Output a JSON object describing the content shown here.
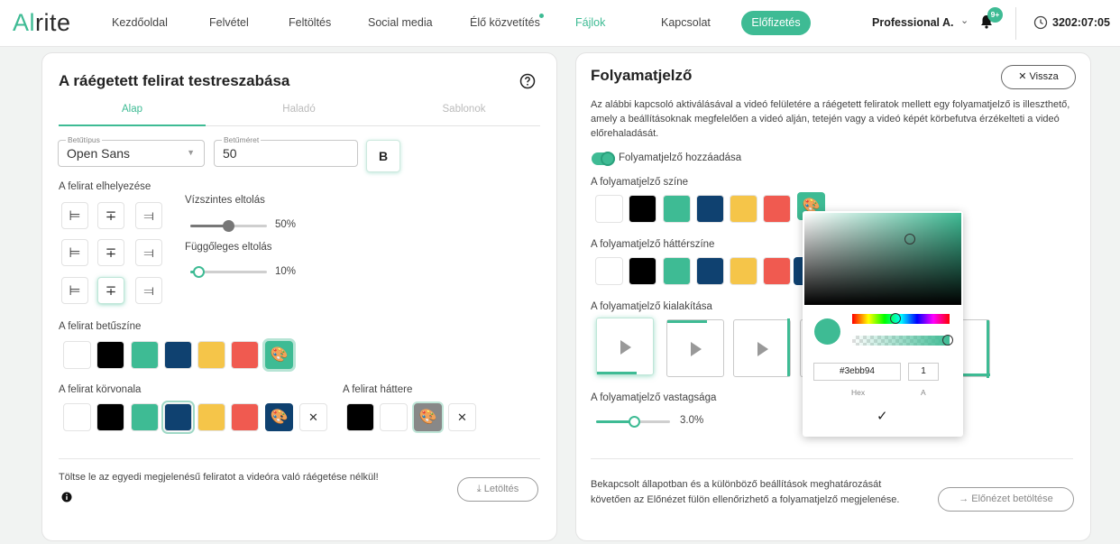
{
  "app": {
    "logo_prefix": "Al",
    "logo_suffix": "rite",
    "nav": [
      "Kezdőoldal",
      "Felvétel",
      "Feltöltés",
      "Social media",
      "Élő közvetítés",
      "Fájlok",
      "Kapcsolat"
    ],
    "subscribe": "Előfizetés",
    "user": "Professional A.",
    "notif_badge": "9+",
    "timer": "3202:07:05"
  },
  "left": {
    "title": "A ráégetett felirat testreszabása",
    "tabs": [
      "Alap",
      "Haladó",
      "Sablonok"
    ],
    "font_label": "Betűtípus",
    "font_value": "Open Sans",
    "size_label": "Betűméret",
    "size_value": "50",
    "bold_label": "B",
    "placement_label": "A felirat elhelyezése",
    "h_offset_label": "Vízszintes eltolás",
    "h_offset_value": "50%",
    "v_offset_label": "Függőleges eltolás",
    "v_offset_value": "10%",
    "font_color_label": "A felirat betűszíne",
    "outline_label": "A felirat körvonala",
    "bg_label": "A felirat háttere",
    "download_text": "Töltse le az egyedi megjelenésű feliratot a videóra való ráégetése nélkül!",
    "download_btn": "Letöltés"
  },
  "right": {
    "title": "Folyamatjelző",
    "back_btn": "Vissza",
    "desc": "Az alábbi kapcsoló aktiválásával a videó felületére a ráégetett feliratok mellett egy folyamatjelző is illeszthető, amely a beállításoknak megfelelően a videó alján, tetején vagy a videó képét körbefutva érzékelteti a videó előrehaladását.",
    "toggle_label": "Folyamatjelző hozzáadása",
    "color_label": "A folyamatjelző színe",
    "bg_color_label": "A folyamatjelző háttérszíne",
    "style_label": "A folyamatjelző kialakítása",
    "thickness_label": "A folyamatjelző vastagsága",
    "thickness_value": "3.0%",
    "footer_text": "Bekapcsolt állapotban és a különböző beállítások meghatározását követően az Előnézet fülön ellenőrizhető a folyamatjelző megjelenése.",
    "preview_btn": "Előnézet betöltése"
  },
  "picker": {
    "hex": "#3ebb94",
    "alpha": "1",
    "hex_label": "Hex",
    "alpha_label": "A"
  },
  "colors": {
    "accent": "#3ebb94",
    "palette": [
      "#ffffff",
      "#000000",
      "#3ebb94",
      "#0f4170",
      "#f5c549",
      "#f05a50"
    ]
  },
  "progress": {
    "h_offset": 0.5,
    "v_offset": 0.1,
    "thickness": 0.03
  }
}
